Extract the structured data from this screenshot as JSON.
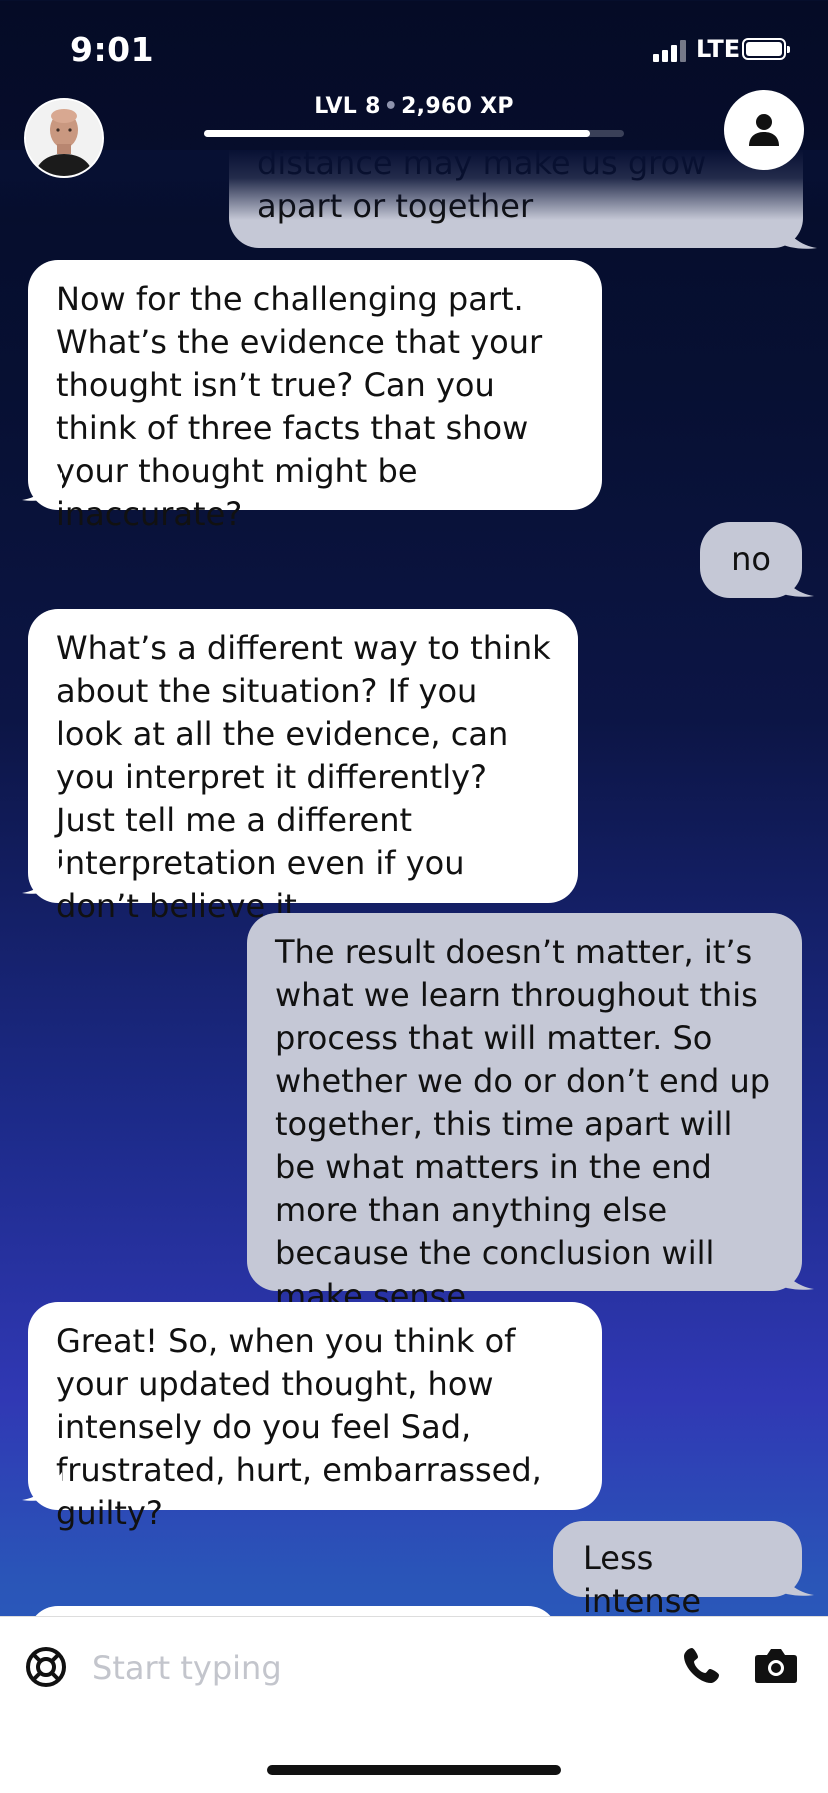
{
  "status_bar": {
    "time": "9:01",
    "network": "LTE"
  },
  "header": {
    "level_label": "LVL 8",
    "xp_label": "2,960 XP",
    "xp_progress": 0.92
  },
  "messages": [
    {
      "sender": "user",
      "text_lines": [
        "distance may make us grow",
        "apart or together"
      ]
    },
    {
      "sender": "bot",
      "text": "Now for the challenging part. What’s the evidence that your thought isn’t true? Can you think of three facts that show your thought might be inaccurate?"
    },
    {
      "sender": "user",
      "text": "no"
    },
    {
      "sender": "bot",
      "text": "What’s a different way to think about the situation? If you look at all the evidence, can you interpret it differently? Just tell me a different interpretation even if you don’t believe it."
    },
    {
      "sender": "user",
      "text": "The result doesn’t matter, it’s what we learn throughout this process that will matter. So whether we do or don’t end up together, this time apart will be what matters in the end more than anything else because the conclusion will make sense"
    },
    {
      "sender": "bot",
      "text": "Great! So, when you think of your updated thought, how intensely do you feel Sad, frustrated, hurt, embarrassed, guilty?"
    },
    {
      "sender": "user",
      "text": "Less intense"
    }
  ],
  "composer": {
    "placeholder": "Start typing"
  },
  "icons": [
    "help-lifebuoy-icon",
    "phone-icon",
    "camera-icon",
    "person-icon"
  ],
  "colors": {
    "bot_bubble": "#ffffff",
    "user_bubble": "#c5c8d6",
    "accent": "#ffffff"
  }
}
